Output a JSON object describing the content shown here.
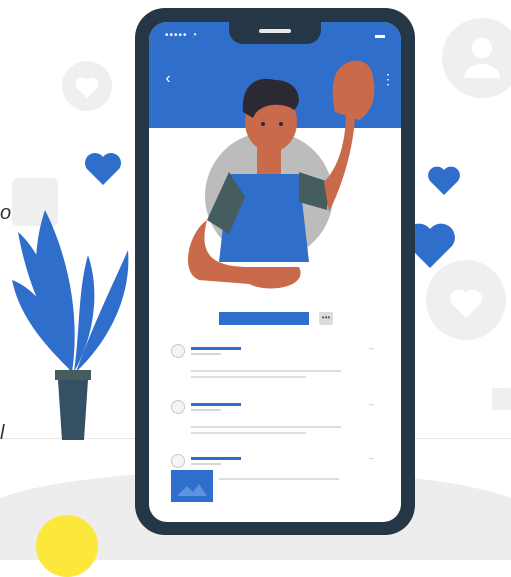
{
  "side_text": [
    "o",
    "l"
  ],
  "phone": {
    "status_left": "••••• ◔",
    "status_right": "▬",
    "back_icon": "chevron-left-icon",
    "more_icon": "more-vertical-icon",
    "edit_icon": "more-horizontal-icon",
    "back_glyph": "‹",
    "more_glyph": "⋮",
    "edit_glyph": "•••",
    "item_menu_glyph": "–"
  },
  "colors": {
    "primary_blue": "#2f6ecb",
    "phone_body": "#253746",
    "skin": "#c96a4a",
    "hair": "#2b2a33",
    "sleeve": "#455d5c",
    "accent_yellow": "#fbe83a"
  }
}
